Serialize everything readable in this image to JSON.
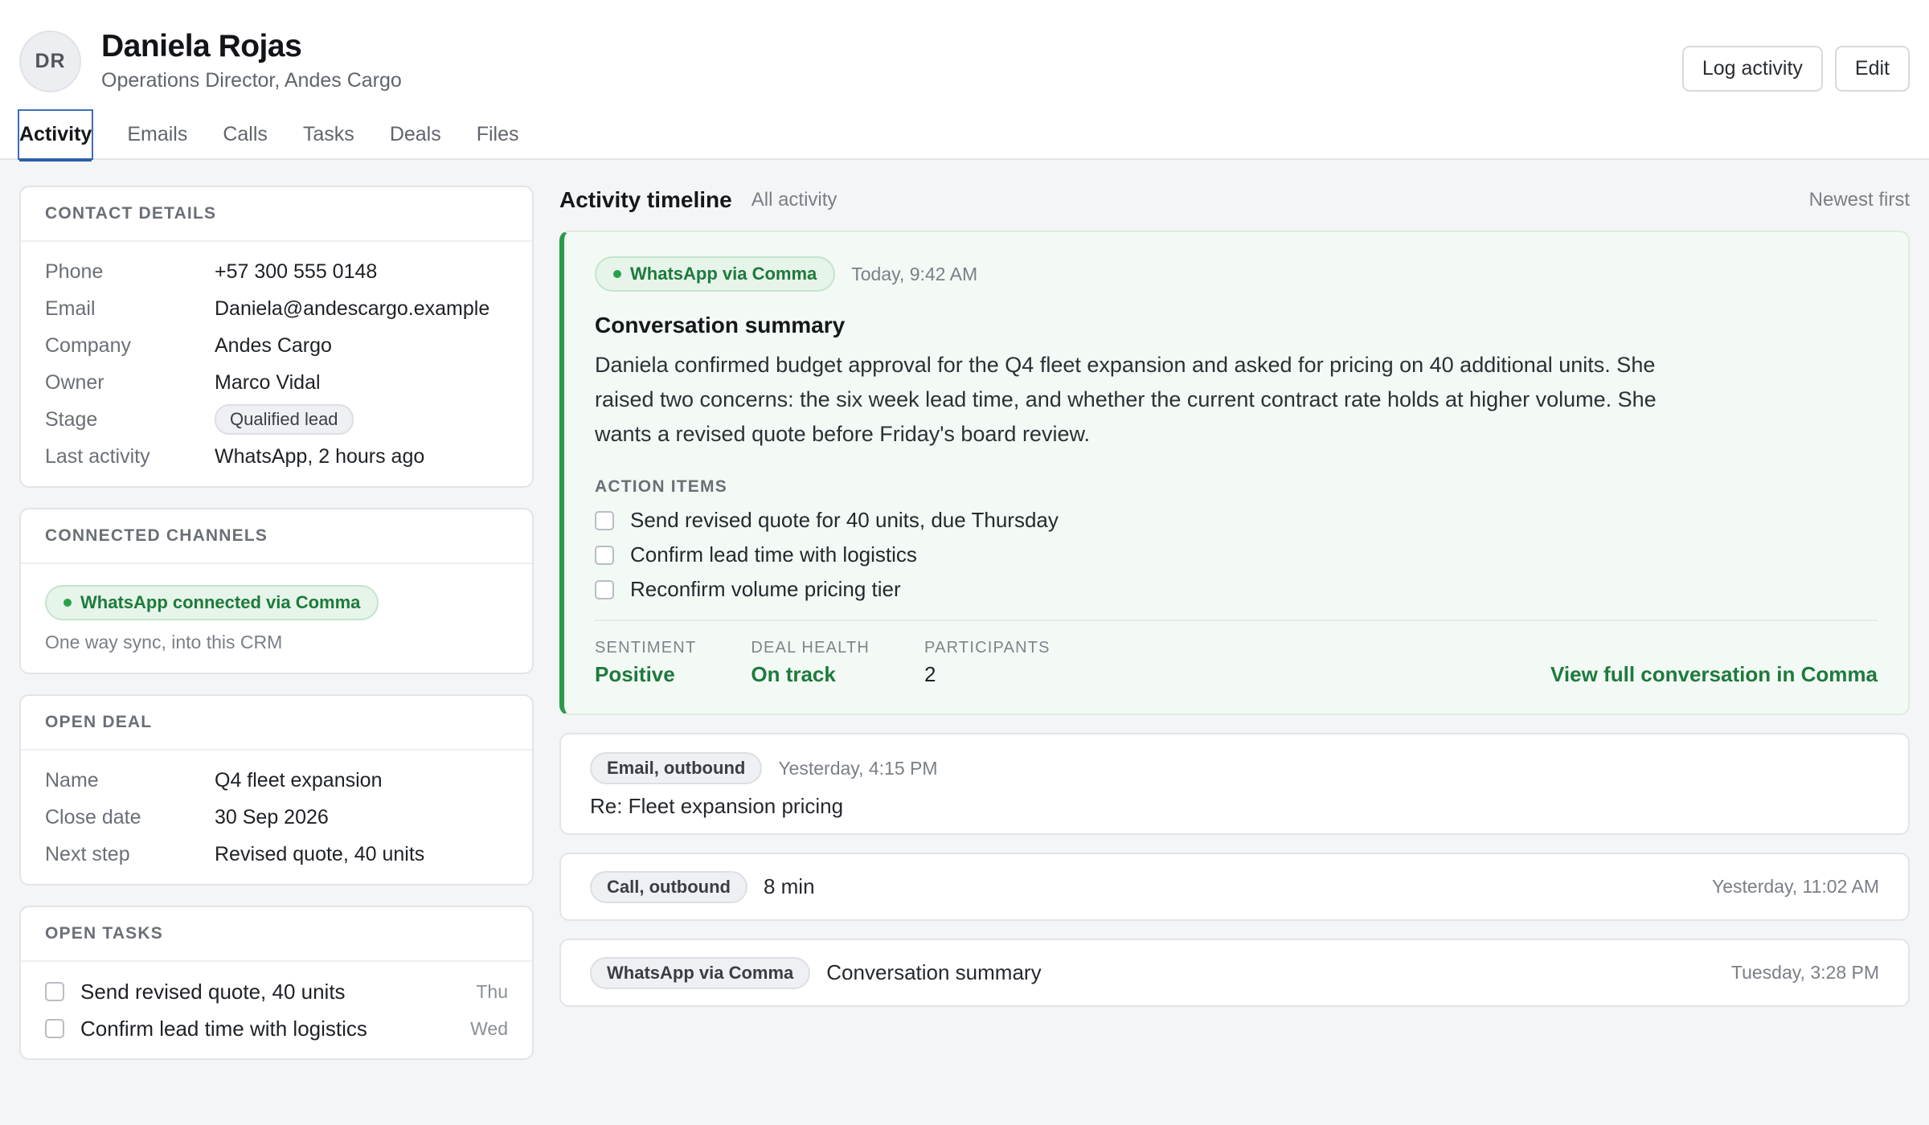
{
  "contact": {
    "initials": "DR",
    "name": "Daniela Rojas",
    "title": "Operations Director, Andes Cargo"
  },
  "header_actions": {
    "log_activity": "Log activity",
    "edit": "Edit"
  },
  "tabs": [
    {
      "label": "Activity",
      "active": true
    },
    {
      "label": "Emails"
    },
    {
      "label": "Calls"
    },
    {
      "label": "Tasks"
    },
    {
      "label": "Deals"
    },
    {
      "label": "Files"
    }
  ],
  "contact_details": {
    "heading": "CONTACT DETAILS",
    "rows": [
      {
        "label": "Phone",
        "value": "+57 300 555 0148"
      },
      {
        "label": "Email",
        "value": "Daniela@andescargo.example"
      },
      {
        "label": "Company",
        "value": "Andes Cargo"
      },
      {
        "label": "Owner",
        "value": "Marco Vidal"
      },
      {
        "label": "Stage",
        "value": "Qualified lead"
      },
      {
        "label": "Last activity",
        "value": "WhatsApp, 2 hours ago"
      }
    ]
  },
  "connected_channels": {
    "heading": "CONNECTED CHANNELS",
    "badge": "WhatsApp connected via Comma",
    "note": "One way sync, into this CRM"
  },
  "open_deal": {
    "heading": "OPEN DEAL",
    "rows": [
      {
        "label": "Name",
        "value": "Q4 fleet expansion"
      },
      {
        "label": "Close date",
        "value": "30 Sep 2026"
      },
      {
        "label": "Next step",
        "value": "Revised quote, 40 units"
      }
    ]
  },
  "open_tasks": {
    "heading": "OPEN TASKS",
    "items": [
      {
        "label": "Send revised quote, 40 units",
        "due": "Thu"
      },
      {
        "label": "Confirm lead time with logistics",
        "due": "Wed"
      }
    ]
  },
  "timeline": {
    "title": "Activity timeline",
    "filter": "All activity",
    "sort": "Newest first",
    "summary": {
      "source": "WhatsApp via Comma",
      "time": "Today, 9:42 AM",
      "title": "Conversation summary",
      "text": "Daniela confirmed budget approval for the Q4 fleet expansion and asked for pricing on 40 additional units. She raised two concerns: the six week lead time, and whether the current contract rate holds at higher volume. She wants a revised quote before Friday's board review.",
      "action_items_heading": "ACTION ITEMS",
      "action_items": [
        "Send revised quote for 40 units, due Thursday",
        "Confirm lead time with logistics",
        "Reconfirm volume pricing tier"
      ],
      "stats": [
        {
          "label": "SENTIMENT",
          "value": "Positive"
        },
        {
          "label": "DEAL HEALTH",
          "value": "On track"
        },
        {
          "label": "PARTICIPANTS",
          "value": "2"
        }
      ],
      "link": "View full conversation in Comma"
    },
    "events": [
      {
        "tag": "Email, outbound",
        "time": "Yesterday, 4:15 PM",
        "text": "Re: Fleet expansion pricing"
      },
      {
        "tag": "Call, outbound",
        "text": "8 min",
        "time": "Yesterday, 11:02 AM"
      },
      {
        "tag": "WhatsApp via Comma",
        "text": "Conversation summary",
        "time": "Tuesday, 3:28 PM"
      }
    ]
  },
  "colors": {
    "accent_green": "#1e7a3c",
    "tab_underline": "#2c5fa8"
  }
}
